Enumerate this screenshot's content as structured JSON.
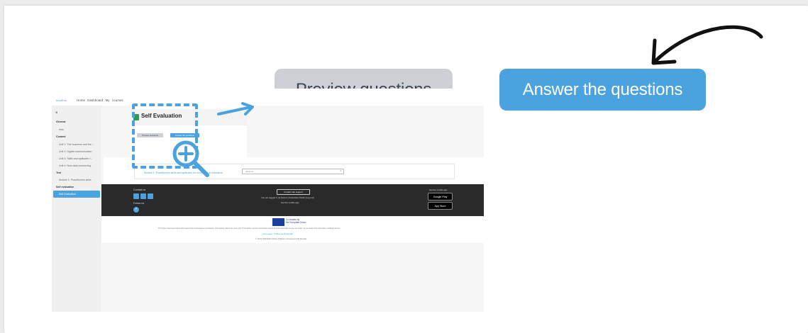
{
  "callouts": {
    "preview_label": "Preview questions",
    "answer_label": "Answer the questions"
  },
  "colors": {
    "accent": "#4aa3df",
    "preview_bg": "#cdd1d6",
    "footer_bg": "#2a2a2a",
    "self_eval_icon": "#2e9a57"
  },
  "screenshot": {
    "logo_text": "InnoEdu",
    "nav": [
      "Home",
      "Dashboard",
      "My courses"
    ],
    "sidebar": {
      "close_icon": "×",
      "items": [
        {
          "label": "General",
          "type": "head"
        },
        {
          "label": "Intro",
          "type": "item"
        },
        {
          "label": "Content",
          "type": "head"
        },
        {
          "label": "Unit 1: The business and the ...",
          "type": "item"
        },
        {
          "label": "Unit 2: Digital communication",
          "type": "item"
        },
        {
          "label": "Unit 3: Skills and aptitudes f...",
          "type": "item"
        },
        {
          "label": "Unit 4: New data concerning",
          "type": "item"
        },
        {
          "label": "Test",
          "type": "head"
        },
        {
          "label": "Module 1: Practitioners skills",
          "type": "item"
        },
        {
          "label": "Self evaluation",
          "type": "head"
        }
      ],
      "active_label": "Self Evaluation"
    },
    "title": "Self Evaluation",
    "preview_button": "Preview questions",
    "answer_button": "Answer the questions",
    "module_link": "Module 1: Practitioners skills and aptitudes for innovation in education",
    "module_select": "Jump to...",
    "footer": {
      "contact_label": "Contact us",
      "follow_label": "Follow us",
      "support_button": "Contact site support",
      "logged_in_text": "You are logged in as Nueva Contenidos Public (Log out)",
      "mobile_app_text": "Get the mobile app",
      "app_heading": "Get the mobile app",
      "google_play": "Google Play",
      "app_store": "App Store"
    },
    "footer_white": {
      "eu_line1": "Co-funded by",
      "eu_line2": "the European Union",
      "disclaimer": "This project has been funded with support from the European Commission. This website reflects the views only of the author, and the Commission cannot be held responsible for any use which may be made of the information contained therein.",
      "links": "Aviso legal · Política de Privacidad",
      "copyright": "© 2023 INNOEDU Online Platform developed with Moodle"
    }
  }
}
